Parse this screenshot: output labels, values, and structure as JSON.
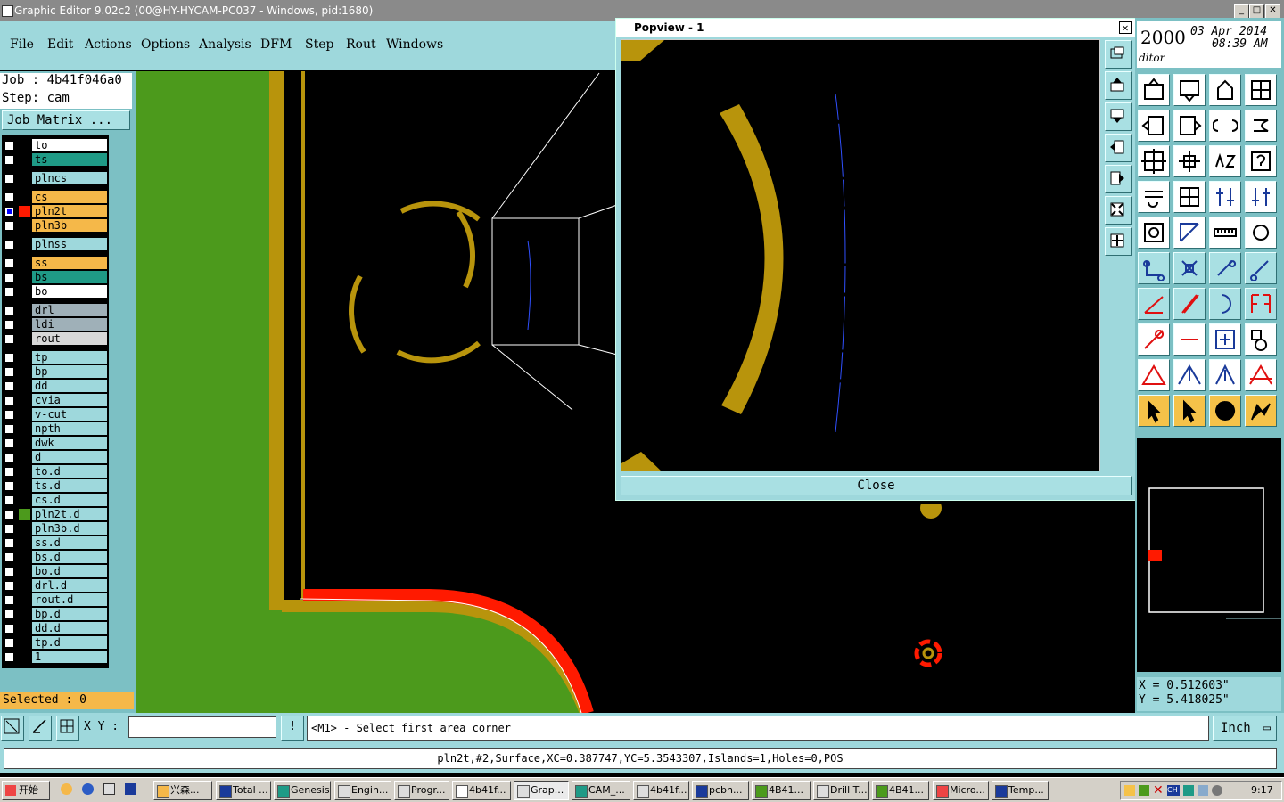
{
  "window": {
    "title": "Graphic Editor 9.02c2 (00@HY-HYCAM-PC037 - Windows, pid:1680)",
    "min": "_",
    "max": "□",
    "close": "✕"
  },
  "menu": [
    "File",
    "Edit",
    "Actions",
    "Options",
    "Analysis",
    "DFM",
    "Step",
    "Rout",
    "Windows"
  ],
  "job": {
    "job_line": "Job : 4b41f046a0",
    "step_line": "Step: cam",
    "matrix_button": "Job Matrix ..."
  },
  "layers": [
    {
      "name": "to",
      "color": "#ffffff"
    },
    {
      "name": "ts",
      "color": "#1f9a86"
    },
    {
      "name": "plncs",
      "color": "#9ed8dc"
    },
    {
      "name": "cs",
      "color": "#f5b849"
    },
    {
      "name": "pln2t",
      "color": "#f5b849"
    },
    {
      "name": "pln3b",
      "color": "#f5b849"
    },
    {
      "name": "plnss",
      "color": "#9ed8dc"
    },
    {
      "name": "ss",
      "color": "#f5b849"
    },
    {
      "name": "bs",
      "color": "#1f9a86"
    },
    {
      "name": "bo",
      "color": "#ffffff"
    },
    {
      "name": "drl",
      "color": "#9fb0b8"
    },
    {
      "name": "ldi",
      "color": "#9fb0b8"
    },
    {
      "name": "rout",
      "color": "#d8d8d8"
    },
    {
      "name": "tp",
      "color": "#9ed8dc"
    },
    {
      "name": "bp",
      "color": "#9ed8dc"
    },
    {
      "name": "dd",
      "color": "#9ed8dc"
    },
    {
      "name": "cvia",
      "color": "#9ed8dc"
    },
    {
      "name": "v-cut",
      "color": "#9ed8dc"
    },
    {
      "name": "npth",
      "color": "#9ed8dc"
    },
    {
      "name": "dwk",
      "color": "#9ed8dc"
    },
    {
      "name": "d",
      "color": "#9ed8dc"
    },
    {
      "name": "to.d",
      "color": "#9ed8dc"
    },
    {
      "name": "ts.d",
      "color": "#9ed8dc"
    },
    {
      "name": "cs.d",
      "color": "#9ed8dc"
    },
    {
      "name": "pln2t.d",
      "color": "#9ed8dc"
    },
    {
      "name": "pln3b.d",
      "color": "#9ed8dc"
    },
    {
      "name": "ss.d",
      "color": "#9ed8dc"
    },
    {
      "name": "bs.d",
      "color": "#9ed8dc"
    },
    {
      "name": "bo.d",
      "color": "#9ed8dc"
    },
    {
      "name": "drl.d",
      "color": "#9ed8dc"
    },
    {
      "name": "rout.d",
      "color": "#9ed8dc"
    },
    {
      "name": "bp.d",
      "color": "#9ed8dc"
    },
    {
      "name": "dd.d",
      "color": "#9ed8dc"
    },
    {
      "name": "tp.d",
      "color": "#9ed8dc"
    },
    {
      "name": "1",
      "color": "#9ed8dc"
    }
  ],
  "selected": "Selected : 0",
  "popview": {
    "title": "Popview - 1",
    "close_button": "Close",
    "close_x": "✕"
  },
  "clock": {
    "year": "2000",
    "date": "03 Apr 2014",
    "time": "08:39 AM",
    "mode": "ditor"
  },
  "coords": {
    "x": "X = 0.512603\"",
    "y": "Y = 5.418025\""
  },
  "command": {
    "xy_label": "X Y :",
    "xy_value": "",
    "prompt": "<M1> - Select first area corner",
    "warn": "!",
    "unit": "Inch"
  },
  "status": "pln2t,#2,Surface,XC=0.387747,YC=5.3543307,Islands=1,Holes=0,POS",
  "taskbar": {
    "start": "开始",
    "tasks": [
      "兴森...",
      "Total ...",
      "Genesis",
      "Engin...",
      "Progr...",
      "4b41f...",
      "Grap...",
      "CAM_...",
      "4b41f...",
      "pcbn...",
      "4B41...",
      "Drill T...",
      "4B41...",
      "Micro...",
      "Temp..."
    ],
    "clock": "9:17"
  },
  "colors": {
    "board_green": "#4c9a1c",
    "copper": "#b8940c",
    "rout_red": "#ff1a00",
    "panel": "#9ed8dc"
  }
}
